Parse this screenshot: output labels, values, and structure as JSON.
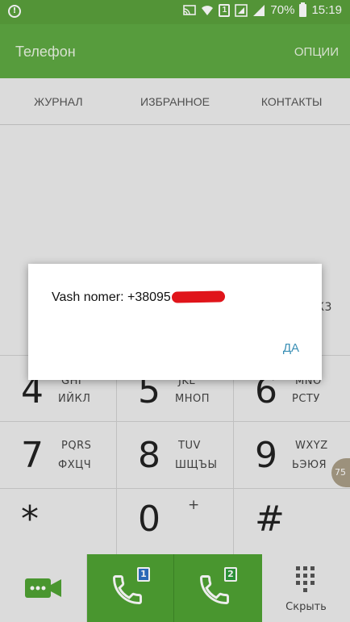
{
  "status_bar": {
    "left_icon": "shield-alert-icon",
    "sim_badge": "1",
    "battery": "70%",
    "time": "15:19"
  },
  "app_bar": {
    "title": "Телефон",
    "options": "ОПЦИИ"
  },
  "tabs": [
    {
      "label": "ЖУРНАЛ"
    },
    {
      "label": "ИЗБРАННОЕ"
    },
    {
      "label": "КОНТАКТЫ"
    }
  ],
  "keypad": {
    "partial_row": {
      "right_text": "К3"
    },
    "row4": [
      {
        "digit": "4",
        "lat": "GHI",
        "cyr": "ИЙКЛ"
      },
      {
        "digit": "5",
        "lat": "JKL",
        "cyr": "МНОП"
      },
      {
        "digit": "6",
        "lat": "MNO",
        "cyr": "РСТУ"
      }
    ],
    "row7": [
      {
        "digit": "7",
        "lat": "PQRS",
        "cyr": "ФХЦЧ"
      },
      {
        "digit": "8",
        "lat": "TUV",
        "cyr": "ШЩЪЫ"
      },
      {
        "digit": "9",
        "lat": "WXYZ",
        "cyr": "ЬЭЮЯ"
      }
    ],
    "row_star": [
      {
        "digit": "*",
        "sub": ""
      },
      {
        "digit": "0",
        "sub": "+"
      },
      {
        "digit": "#",
        "sub": ""
      }
    ]
  },
  "edge_badge": "75",
  "bottom_bar": {
    "video_icon": "video-call-icon",
    "sim1_label": "1",
    "sim2_label": "2",
    "hide_label": "Скрыть"
  },
  "dialog": {
    "message_prefix": "Vash nomer: +38095",
    "confirm": "ДА"
  },
  "colors": {
    "header_green": "#5ea842",
    "call_green": "#4fa233",
    "dialog_button": "#3a8fb5",
    "redaction": "#e0141a"
  }
}
